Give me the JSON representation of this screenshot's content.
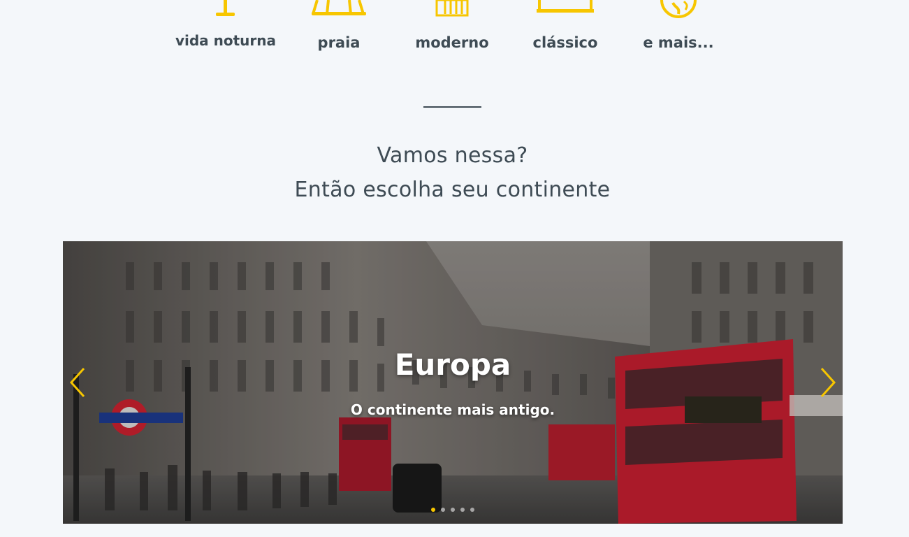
{
  "colors": {
    "accent": "#f7c600",
    "text": "#3e4b54",
    "background": "#f4f7fa"
  },
  "categories": [
    {
      "label": "vida noturna",
      "icon": "cocktail-icon"
    },
    {
      "label": "praia",
      "icon": "beach-umbrella-icon"
    },
    {
      "label": "moderno",
      "icon": "skyscraper-icon"
    },
    {
      "label": "clássico",
      "icon": "classic-building-icon"
    },
    {
      "label": "e mais...",
      "icon": "globe-icon"
    }
  ],
  "heading": {
    "line1": "Vamos nessa?",
    "line2": "Então escolha seu continente"
  },
  "carousel": {
    "slide_title": "Europa",
    "slide_caption": "O continente mais antigo.",
    "slide_count": 5,
    "active_index": 0,
    "prev_icon": "chevron-left-icon",
    "next_icon": "chevron-right-icon"
  }
}
